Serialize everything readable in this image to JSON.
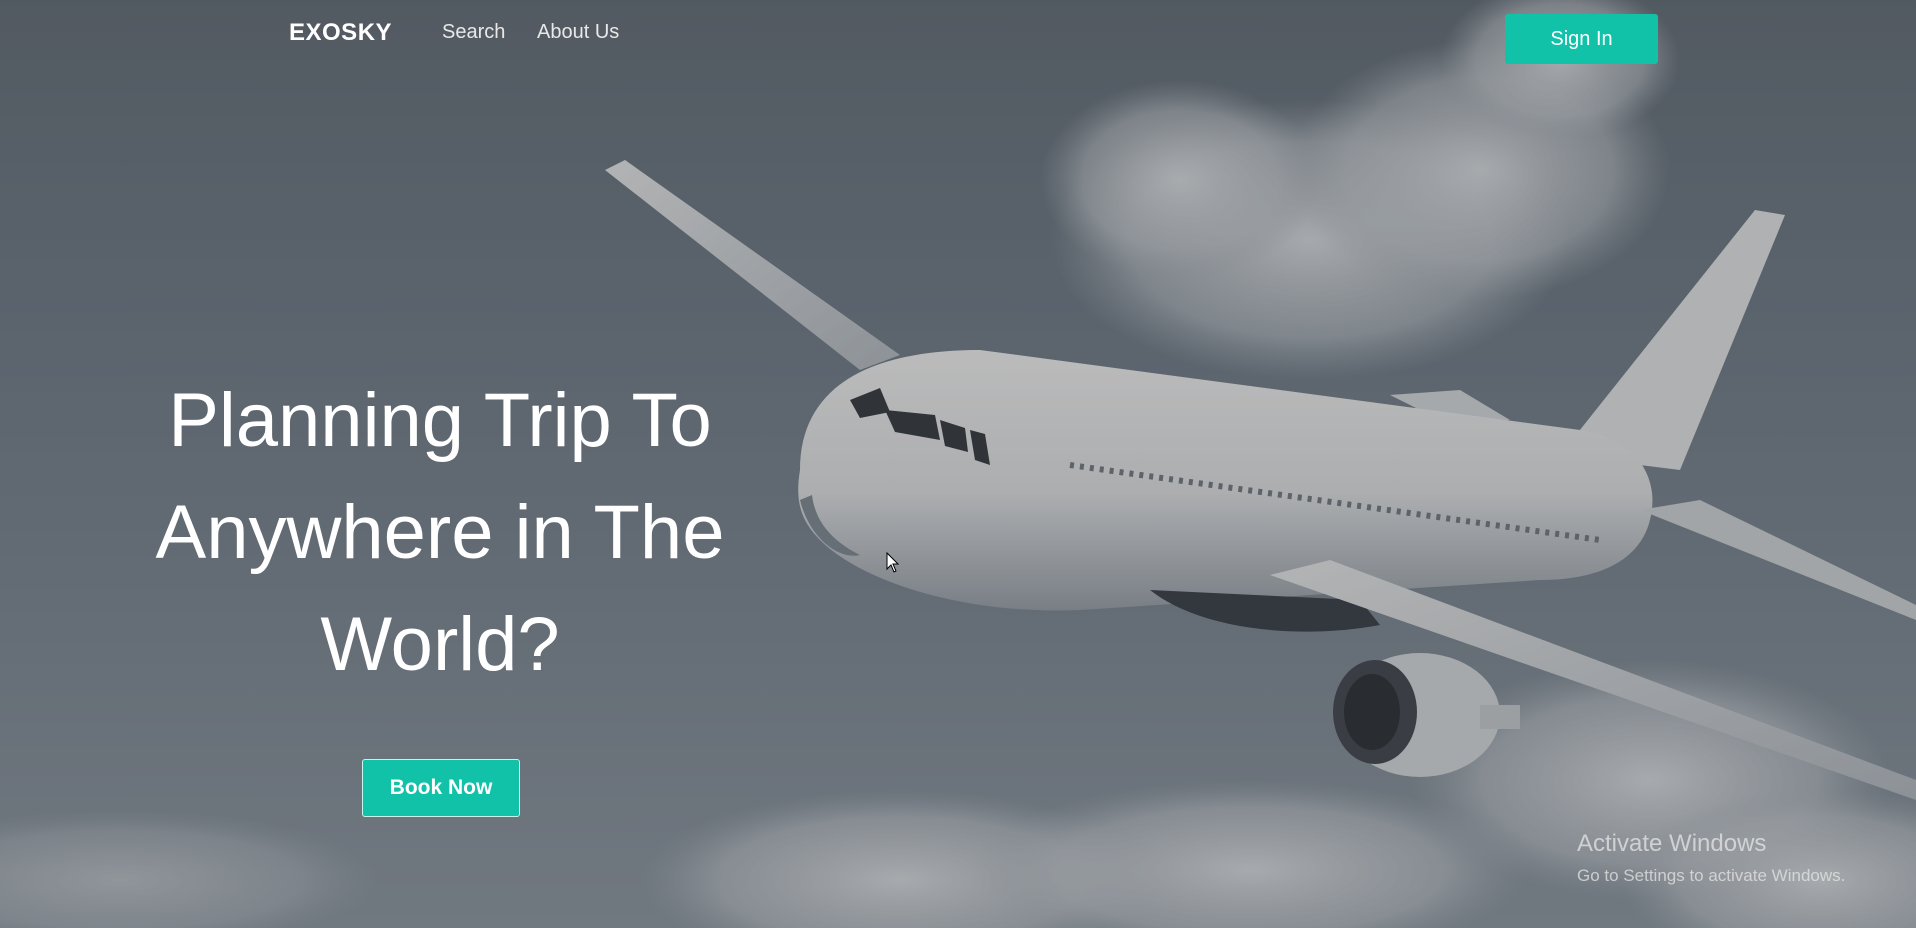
{
  "nav": {
    "brand": "EXOSKY",
    "links": [
      {
        "label": "Search"
      },
      {
        "label": "About Us"
      }
    ],
    "signin_label": "Sign In"
  },
  "hero": {
    "title_lines": [
      "Planning Trip To",
      "Anywhere in The",
      "World?"
    ],
    "cta_label": "Book Now"
  },
  "watermark": {
    "title": "Activate Windows",
    "subtitle": "Go to Settings to activate Windows."
  },
  "colors": {
    "accent": "#12c2a8",
    "text": "#ffffff"
  },
  "icons": {
    "cursor": "mouse-pointer-icon"
  }
}
